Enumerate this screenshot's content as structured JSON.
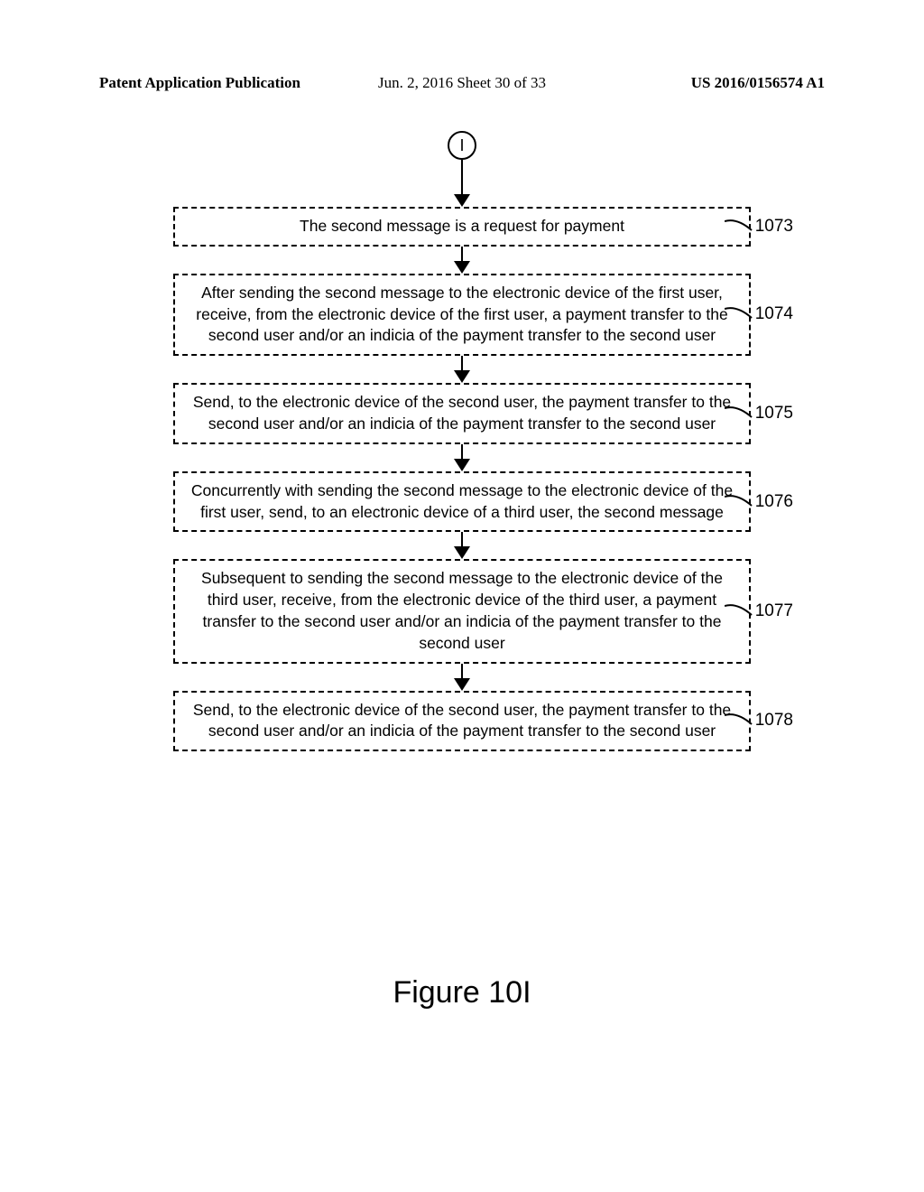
{
  "header": {
    "left": "Patent Application Publication",
    "mid": "Jun. 2, 2016  Sheet 30 of 33",
    "right": "US 2016/0156574 A1"
  },
  "connector": "I",
  "steps": [
    {
      "ref": "1073",
      "text": "The second message is a request for payment"
    },
    {
      "ref": "1074",
      "text": "After sending the second message to the electronic device of the first user, receive, from the electronic device of the first user, a payment transfer to the second user and/or an indicia of the payment transfer to the second user"
    },
    {
      "ref": "1075",
      "text": "Send, to the electronic device of the second user, the payment transfer to the second user and/or an indicia of the payment transfer to the second user"
    },
    {
      "ref": "1076",
      "text": "Concurrently with sending the second message to the electronic device of the first user, send, to an electronic device of a third user, the second message"
    },
    {
      "ref": "1077",
      "text": "Subsequent to sending the second message to the electronic device of the third user, receive, from the electronic device of the third user, a payment transfer to the second user and/or an indicia of the payment transfer to the second user"
    },
    {
      "ref": "1078",
      "text": "Send, to the electronic device of the second user, the payment transfer to the second user and/or an indicia of the payment transfer to the second user"
    }
  ],
  "figure_title": "Figure 10I"
}
